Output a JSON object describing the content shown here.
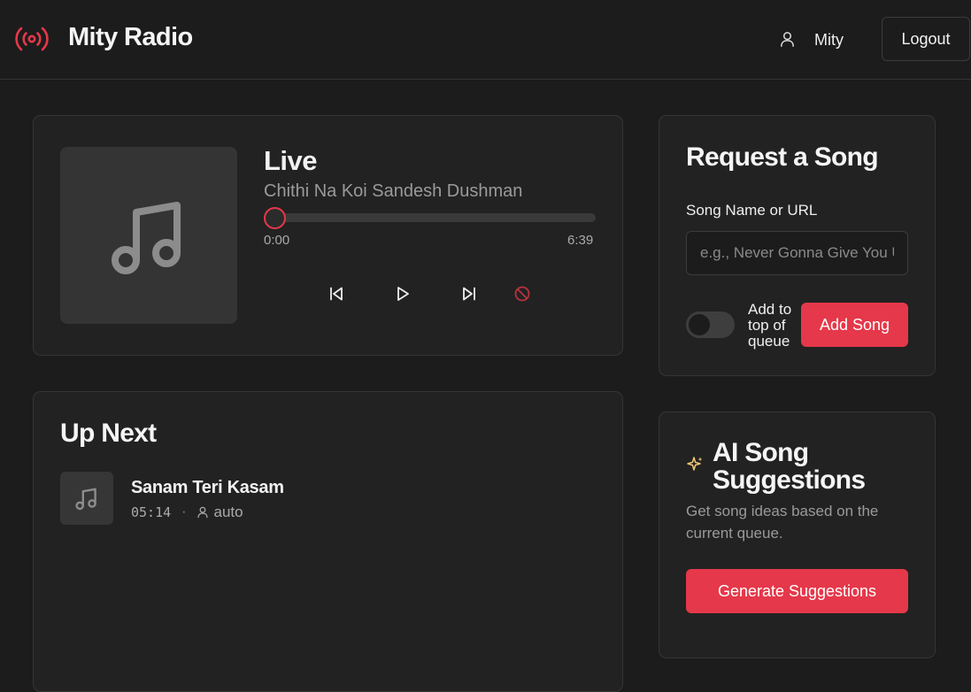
{
  "header": {
    "app_title": "Mity Radio",
    "user_name": "Mity",
    "logout_label": "Logout"
  },
  "player": {
    "status": "Live",
    "song_title": "Chithi Na Koi Sandesh Dushman",
    "time_current": "0:00",
    "time_total": "6:39",
    "progress": 0
  },
  "request": {
    "heading": "Request a Song",
    "field_label": "Song Name or URL",
    "placeholder": "e.g., Never Gonna Give You Up",
    "toggle_label": "Add to top of queue",
    "toggle_on": false,
    "add_label": "Add Song"
  },
  "up_next": {
    "heading": "Up Next",
    "items": [
      {
        "title": "Sanam Teri Kasam",
        "duration": "05:14",
        "added_by": "auto"
      }
    ]
  },
  "ai": {
    "heading": "AI Song Suggestions",
    "description": "Get song ideas based on the current queue.",
    "button_label": "Generate Suggestions"
  },
  "colors": {
    "accent": "#e5384a",
    "background": "#1c1c1c",
    "card": "#222222",
    "sparkle": "#f0c674"
  },
  "icons": {
    "logo": "radio-broadcast-icon",
    "user": "user-icon",
    "album": "music-note-icon",
    "prev": "skip-back-icon",
    "play": "play-icon",
    "next": "skip-forward-icon",
    "block": "ban-icon",
    "ai": "sparkle-icon"
  }
}
